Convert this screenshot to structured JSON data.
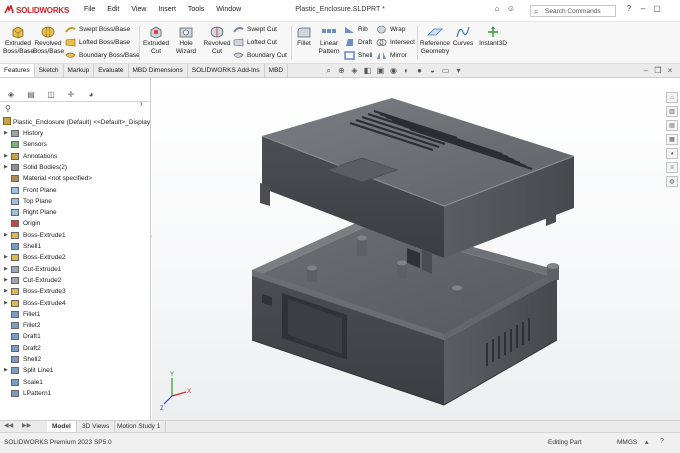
{
  "app": {
    "logo": "SOLIDWORKS",
    "document_title": "Plastic_Enclosure.SLDPRT *",
    "search_placeholder": "Search Commands"
  },
  "menu": {
    "items": [
      "File",
      "Edit",
      "View",
      "Insert",
      "Tools",
      "Window"
    ]
  },
  "ribbon": {
    "extruded_boss": [
      "Extruded",
      "Boss/Base"
    ],
    "revolved_boss": [
      "Revolved",
      "Boss/Base"
    ],
    "swept_boss": "Swept Boss/Base",
    "lofted_boss": "Lofted Boss/Base",
    "boundary_boss": "Boundary Boss/Base",
    "extruded_cut": [
      "Extruded",
      "Cut"
    ],
    "hole_wizard": [
      "Hole",
      "Wizard"
    ],
    "revolved_cut": [
      "Revolved",
      "Cut"
    ],
    "swept_cut": "Swept Cut",
    "lofted_cut": "Lofted Cut",
    "boundary_cut": "Boundary Cut",
    "fillet": "Fillet",
    "linear_pattern": [
      "Linear",
      "Pattern"
    ],
    "rib": "Rib",
    "draft": "Draft",
    "shell": "Shell",
    "wrap": "Wrap",
    "intersect": "Intersect",
    "mirror": "Mirror",
    "reference_geometry": [
      "Reference",
      "Geometry"
    ],
    "curves": "Curves",
    "instant3d": "Instant3D"
  },
  "tabs": [
    "Features",
    "Sketch",
    "Markup",
    "Evaluate",
    "MBD Dimensions",
    "SOLIDWORKS Add-Ins",
    "MBD"
  ],
  "feature_tree": {
    "root": "Plastic_Enclosure  (Default) <<Default>_Display",
    "items": [
      {
        "label": "History",
        "expandable": true,
        "icon": "history-icon"
      },
      {
        "label": "Sensors",
        "expandable": false,
        "icon": "sensors-icon"
      },
      {
        "label": "Annotations",
        "expandable": true,
        "icon": "annotations-icon"
      },
      {
        "label": "Solid Bodies(2)",
        "expandable": true,
        "icon": "solid-bodies-icon"
      },
      {
        "label": "Material <not specified>",
        "expandable": false,
        "icon": "material-icon"
      },
      {
        "label": "Front Plane",
        "expandable": false,
        "icon": "plane-icon"
      },
      {
        "label": "Top Plane",
        "expandable": false,
        "icon": "plane-icon"
      },
      {
        "label": "Right Plane",
        "expandable": false,
        "icon": "plane-icon"
      },
      {
        "label": "Origin",
        "expandable": false,
        "icon": "origin-icon"
      },
      {
        "label": "Boss-Extrude1",
        "expandable": true,
        "icon": "extrude-icon"
      },
      {
        "label": "Shell1",
        "expandable": false,
        "icon": "shell-icon"
      },
      {
        "label": "Boss-Extrude2",
        "expandable": true,
        "icon": "extrude-icon"
      },
      {
        "label": "Cut-Extrude1",
        "expandable": true,
        "icon": "cut-extrude-icon"
      },
      {
        "label": "Cut-Extrude2",
        "expandable": true,
        "icon": "cut-extrude-icon"
      },
      {
        "label": "Boss-Extrude3",
        "expandable": true,
        "icon": "extrude-icon"
      },
      {
        "label": "Boss-Extrude4",
        "expandable": true,
        "icon": "extrude-icon"
      },
      {
        "label": "Fillet1",
        "expandable": false,
        "icon": "fillet-icon"
      },
      {
        "label": "Fillet2",
        "expandable": false,
        "icon": "fillet-icon"
      },
      {
        "label": "Draft1",
        "expandable": false,
        "icon": "draft-icon"
      },
      {
        "label": "Draft2",
        "expandable": false,
        "icon": "draft-icon"
      },
      {
        "label": "Shell2",
        "expandable": false,
        "icon": "shell-icon"
      },
      {
        "label": "Split Line1",
        "expandable": true,
        "icon": "split-line-icon"
      },
      {
        "label": "Scale1",
        "expandable": false,
        "icon": "scale-icon"
      },
      {
        "label": "LPattern1",
        "expandable": false,
        "icon": "pattern-icon"
      }
    ]
  },
  "bottom_tabs": [
    "Model",
    "3D Views",
    "Motion Study 1"
  ],
  "status": {
    "version": "SOLIDWORKS Premium 2023 SP5.0",
    "mode": "Editing Part",
    "units": "MMGS"
  },
  "colors": {
    "brand_red": "#d0202a",
    "model_body": "#54585d",
    "model_top": "#6d7176"
  }
}
